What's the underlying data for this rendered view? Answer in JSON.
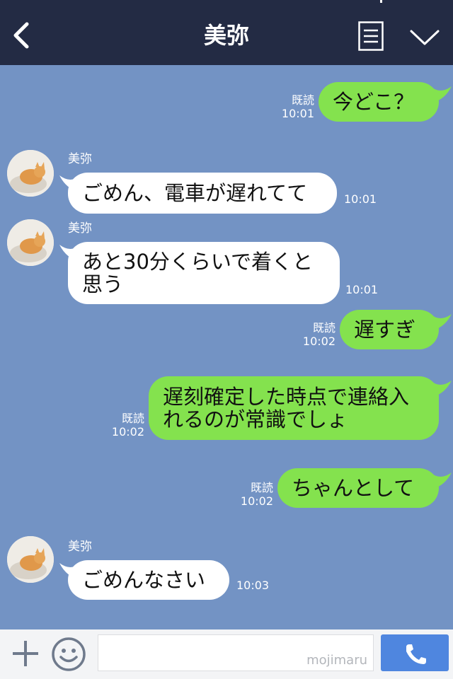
{
  "header": {
    "title": "美弥"
  },
  "messages": [
    {
      "type": "out",
      "text": "今どこ？",
      "read": "既読",
      "time": "10:01"
    },
    {
      "type": "in",
      "name": "美弥",
      "text": "ごめん、電車が遅れてて",
      "time": "10:01"
    },
    {
      "type": "in",
      "name": "美弥",
      "text": "あと30分くらいで着くと思う",
      "time": "10:01"
    },
    {
      "type": "out",
      "text": "遅すぎ",
      "read": "既読",
      "time": "10:02"
    },
    {
      "type": "out",
      "text": "遅刻確定した時点で連絡入れるのが常識でしょ",
      "read": "既読",
      "time": "10:02"
    },
    {
      "type": "out",
      "text": "ちゃんとして",
      "read": "既読",
      "time": "10:02"
    },
    {
      "type": "in",
      "name": "美弥",
      "text": "ごめんなさい",
      "time": "10:03"
    }
  ],
  "footer": {
    "watermark": "mojimaru",
    "input_value": ""
  },
  "colors": {
    "header": "#232b44",
    "chat_bg": "#7393c4",
    "out_bubble": "#84e24e",
    "in_bubble": "#ffffff",
    "call_button": "#4f86df"
  },
  "icons": [
    "back-icon",
    "menu-icon",
    "chevron-down-icon",
    "plus-icon",
    "emoji-icon",
    "phone-icon"
  ]
}
